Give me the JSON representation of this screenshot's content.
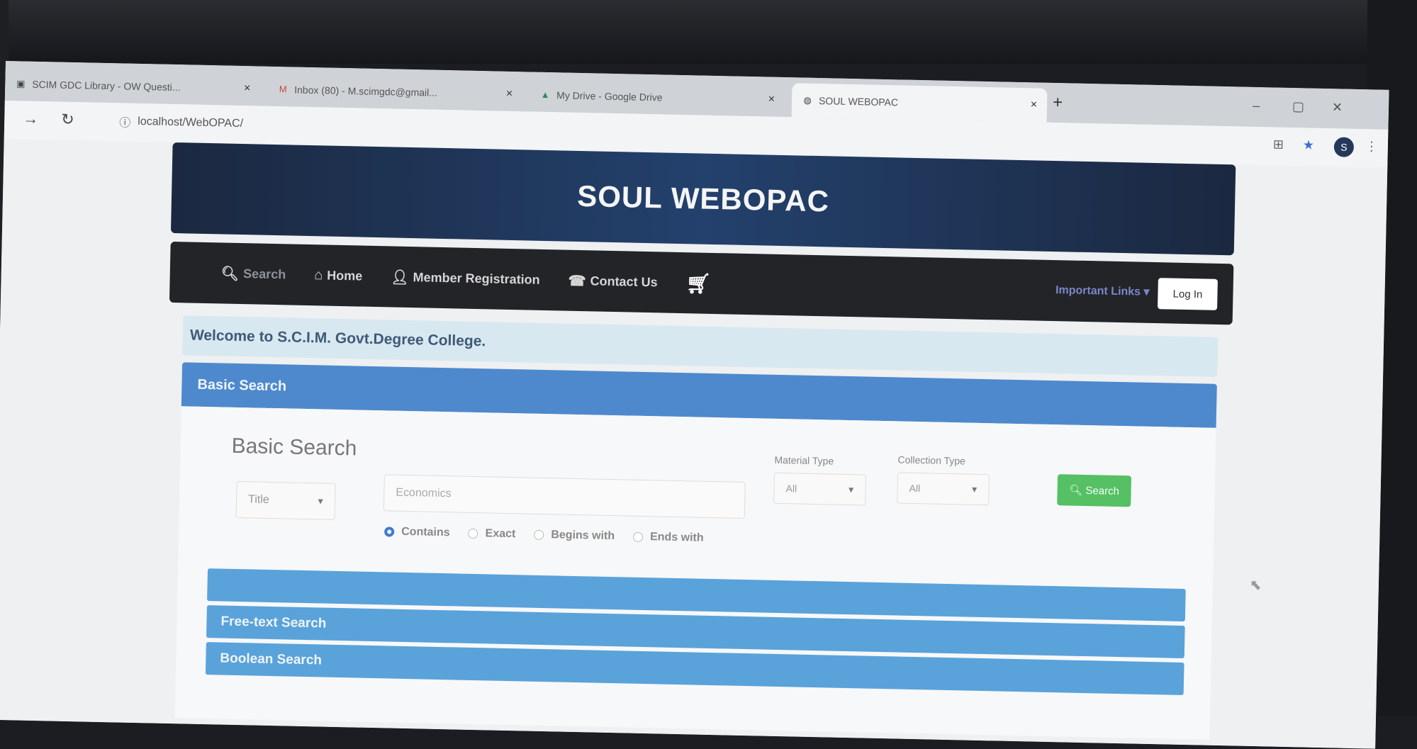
{
  "browser": {
    "tabs": [
      {
        "label": "SCIM GDC Library - OW Questi...",
        "icon": "library-favicon"
      },
      {
        "label": "Inbox (80) - M.scimgdc@gmail...",
        "icon": "gmail-favicon"
      },
      {
        "label": "My Drive - Google Drive",
        "icon": "drive-favicon"
      },
      {
        "label": "SOUL WEBOPAC",
        "icon": "globe-favicon",
        "active": true
      }
    ],
    "close_glyph": "×",
    "new_tab_glyph": "+",
    "url": "localhost/WebOPAC/",
    "profile_initial": "S"
  },
  "site": {
    "title": "SOUL WEBOPAC",
    "nav": [
      {
        "label": "Search",
        "icon": "search-icon"
      },
      {
        "label": "Home",
        "icon": "home-icon"
      },
      {
        "label": "Member Registration",
        "icon": "user-icon"
      },
      {
        "label": "Contact Us",
        "icon": "phone-icon"
      }
    ],
    "cart_icon": "cart-icon",
    "important_links": "Important Links ▾",
    "login": "Log In",
    "welcome": "Welcome to S.C.I.M. Govt.Degree College."
  },
  "basic_search": {
    "panel_title": "Basic Search",
    "heading": "Basic Search",
    "field_select": "Title",
    "input_value": "Economics",
    "material_type_label": "Material Type",
    "material_type_value": "All",
    "collection_type_label": "Collection Type",
    "collection_type_value": "All",
    "search_button": "Search",
    "match_options": [
      {
        "label": "Contains",
        "selected": true
      },
      {
        "label": "Exact",
        "selected": false
      },
      {
        "label": "Begins with",
        "selected": false
      },
      {
        "label": "Ends with",
        "selected": false
      }
    ]
  },
  "accordions": [
    "",
    "Free-text Search",
    "Boolean Search"
  ],
  "colors": {
    "banner": "#23416d",
    "navbar": "#222428",
    "panel": "#4e89cd",
    "accordion": "#5aa2da",
    "search_button": "#55c064"
  }
}
